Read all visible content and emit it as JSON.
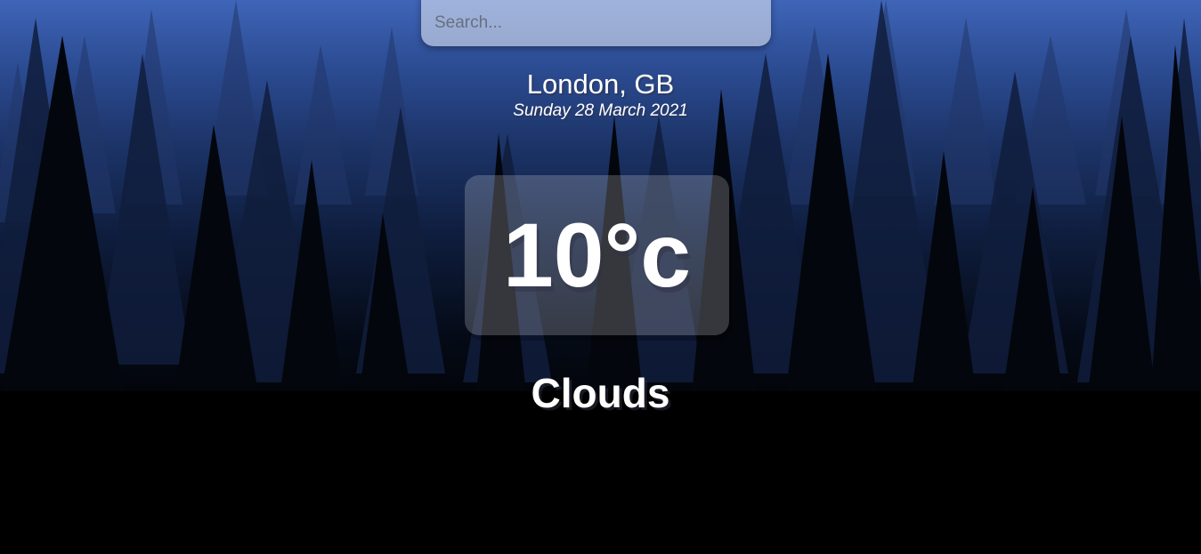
{
  "search": {
    "placeholder": "Search...",
    "value": ""
  },
  "location": {
    "city_country": "London, GB",
    "date": "Sunday 28 March 2021"
  },
  "weather": {
    "temperature": "10°c",
    "condition": "Clouds"
  },
  "colors": {
    "sky_top": "#3f65b8",
    "sky_mid": "#0f1e3f",
    "ground": "#000000",
    "text": "#ffffff"
  },
  "icons": []
}
